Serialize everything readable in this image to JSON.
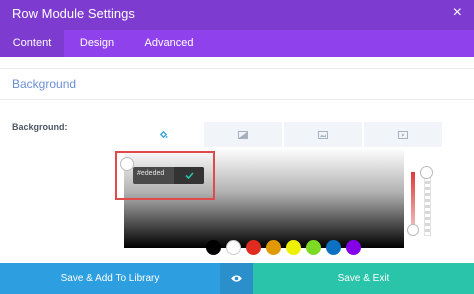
{
  "modal": {
    "title": "Row Module Settings",
    "close_glyph": "×"
  },
  "tabs": [
    {
      "label": "Content",
      "active": true
    },
    {
      "label": "Design",
      "active": false
    },
    {
      "label": "Advanced",
      "active": false
    }
  ],
  "section": {
    "title": "Background"
  },
  "field": {
    "label": "Background:"
  },
  "bg_types": [
    {
      "icon": "paint-bucket-icon",
      "active": true
    },
    {
      "icon": "image-icon",
      "active": false
    },
    {
      "icon": "video-icon",
      "active": false
    },
    {
      "icon": "gradient-icon",
      "active": false
    }
  ],
  "color_picker": {
    "hex_value": "#ededed",
    "confirm_icon": "check-icon"
  },
  "palette": [
    {
      "color": "#000000"
    },
    {
      "color": "#ffffff"
    },
    {
      "color": "#e02b20"
    },
    {
      "color": "#e09900"
    },
    {
      "color": "#edf000"
    },
    {
      "color": "#7cda24"
    },
    {
      "color": "#0c71c3"
    },
    {
      "color": "#8300e9"
    }
  ],
  "footer": {
    "library_label": "Save & Add To Library",
    "eye_icon": "eye-icon",
    "save_label": "Save & Exit"
  },
  "colors": {
    "header": "#7e3bd0",
    "tabs_bg": "#8f42ec",
    "library_btn": "#2d9ee0",
    "save_btn": "#29c4a9",
    "section_title": "#6a8fd6",
    "highlight": "#e04a4a"
  }
}
